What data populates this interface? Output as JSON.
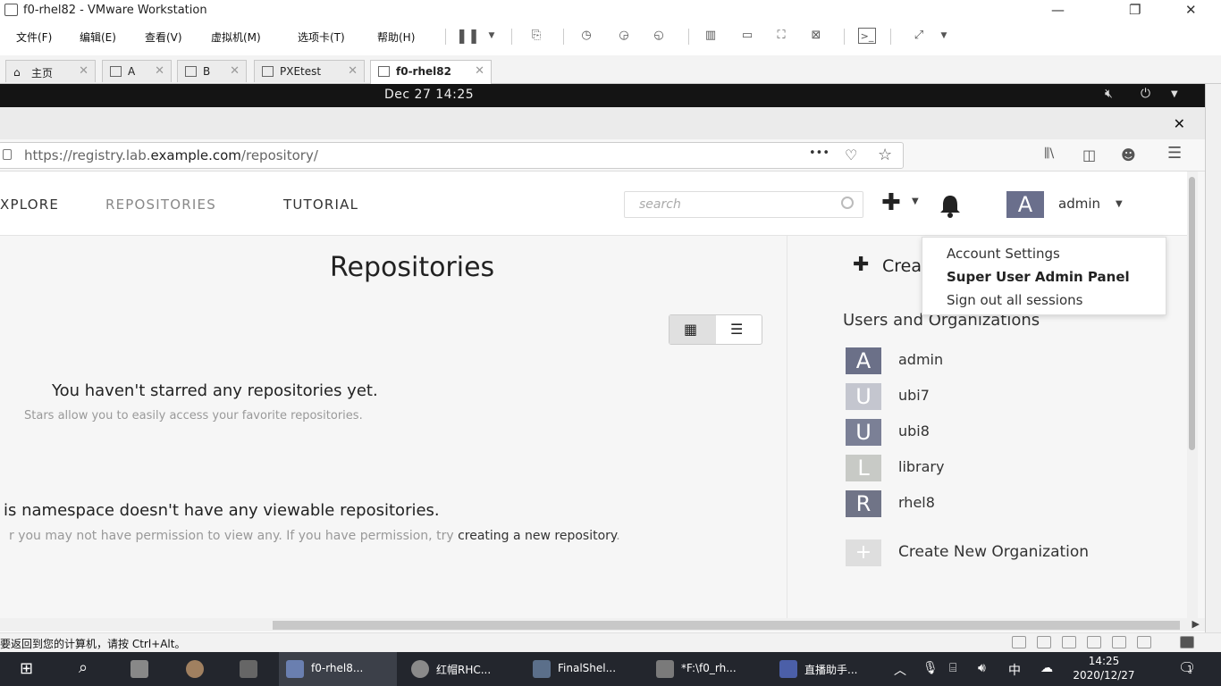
{
  "window": {
    "title": "f0-rhel82 - VMware Workstation",
    "controls": [
      "—",
      "❐",
      "✕"
    ]
  },
  "vm_menu": [
    "文件(F)",
    "编辑(E)",
    "查看(V)",
    "虚拟机(M)",
    "选项卡(T)",
    "帮助(H)"
  ],
  "vm_tabs": [
    {
      "label": "主页",
      "active": false
    },
    {
      "label": "A",
      "active": false
    },
    {
      "label": "B",
      "active": false
    },
    {
      "label": "PXEtest",
      "active": false
    },
    {
      "label": "f0-rhel82",
      "active": true
    }
  ],
  "gnome": {
    "clock": "Dec 27  14:25"
  },
  "browser": {
    "url_prefix": "https://registry.lab.",
    "url_host": "example.com",
    "url_suffix": "/repository/",
    "more": "•••"
  },
  "quay": {
    "nav": {
      "explore": "XPLORE",
      "repositories": "REPOSITORIES",
      "tutorial": "TUTORIAL"
    },
    "search_placeholder": "search",
    "user": {
      "initial": "A",
      "name": "admin"
    },
    "heading": "Repositories",
    "empty_starred": {
      "title": "You haven't starred any repositories yet.",
      "subtitle": "Stars allow you to easily access your favorite repositories."
    },
    "empty_namespace": {
      "title": "is namespace doesn't have any viewable repositories.",
      "subtitle": "r you may not have permission to view any. If you have permission, try ",
      "link": "creating a new repository",
      "end": "."
    },
    "create_label": "Crea",
    "orgs_title": "Users and Organizations",
    "orgs": [
      {
        "initial": "A",
        "name": "admin",
        "color": "#6b7088"
      },
      {
        "initial": "U",
        "name": "ubi7",
        "color": "#c4c6cf"
      },
      {
        "initial": "U",
        "name": "ubi8",
        "color": "#7b8096"
      },
      {
        "initial": "L",
        "name": "library",
        "color": "#c8cac6"
      },
      {
        "initial": "R",
        "name": "rhel8",
        "color": "#707487"
      }
    ],
    "new_org_icon": "+",
    "new_org": "Create New Organization",
    "dropdown": [
      "Account Settings",
      "Super User Admin Panel",
      "Sign out all sessions"
    ]
  },
  "vm_status": {
    "message": "要返回到您的计算机，请按 Ctrl+Alt。"
  },
  "taskbar": {
    "apps": [
      {
        "label": "f0-rhel8...",
        "color": "#6a7fb0",
        "selected": true
      },
      {
        "label": "红帽RHC...",
        "color": "#8a8a8a",
        "selected": false
      },
      {
        "label": "FinalShel...",
        "color": "#5b6f8a",
        "selected": false
      },
      {
        "label": "*F:\\f0_rh...",
        "color": "#7a7a7a",
        "selected": false
      },
      {
        "label": "直播助手...",
        "color": "#4b5fa8",
        "selected": false
      }
    ],
    "time": "14:25",
    "date": "2020/12/27",
    "ime": "中",
    "notifications": "1"
  }
}
